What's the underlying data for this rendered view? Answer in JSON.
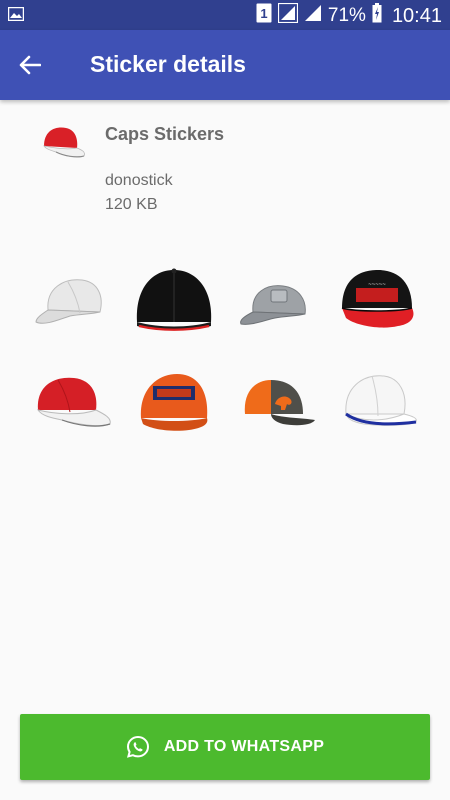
{
  "status_bar": {
    "left_icon": "image-icon",
    "sim_badge": "1",
    "battery_percent": "71%",
    "time": "10:41",
    "background": "#30408f"
  },
  "app_bar": {
    "title": "Sticker details",
    "back_icon": "arrow-back-icon",
    "background": "#3f51b5"
  },
  "pack": {
    "name": "Caps Stickers",
    "publisher": "donostick",
    "size": "120 KB",
    "tray_icon": "red-cap-icon"
  },
  "stickers": [
    {
      "icon": "white-cap-sticker"
    },
    {
      "icon": "black-cap-sticker"
    },
    {
      "icon": "grey-cap-sticker"
    },
    {
      "icon": "black-red-snapback-sticker"
    },
    {
      "icon": "red-white-cap-sticker"
    },
    {
      "icon": "orange-crush-cap-sticker"
    },
    {
      "icon": "orange-grey-cap-sticker"
    },
    {
      "icon": "white-blue-cap-sticker"
    }
  ],
  "add_button": {
    "label": "ADD TO WHATSAPP",
    "icon": "whatsapp-icon",
    "color": "#4cba2e"
  }
}
